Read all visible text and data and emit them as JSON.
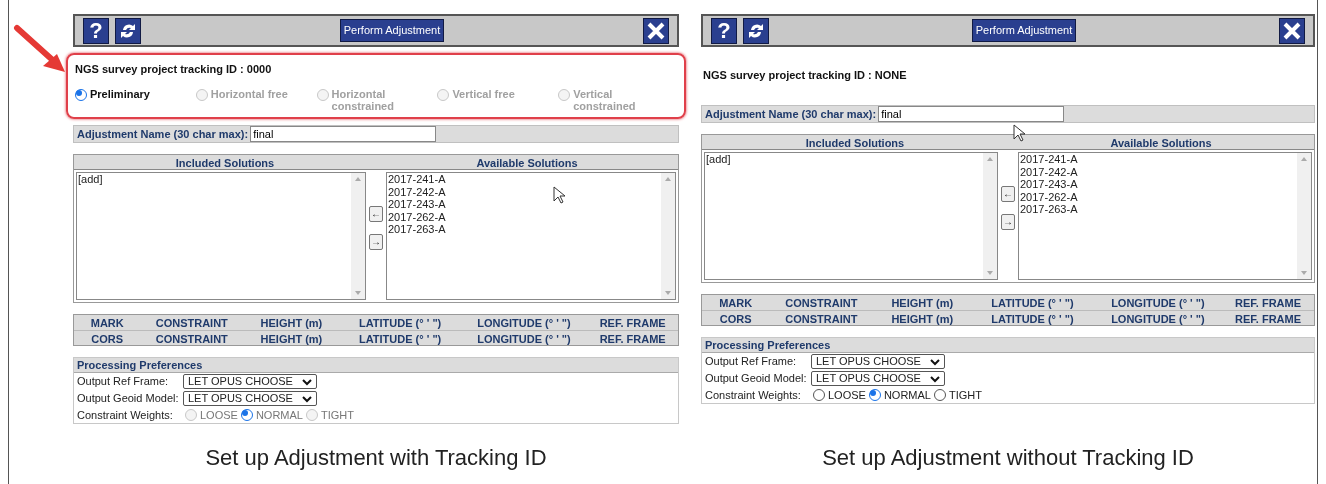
{
  "panels": [
    {
      "toolbar": {
        "help_key": "?",
        "action": "Perform Adjustment"
      },
      "tracking": {
        "label": "NGS survey project tracking ID : 0000",
        "highlighted": true,
        "options": [
          {
            "label": "Preliminary",
            "selected": true,
            "disabled": false
          },
          {
            "label": "Horizontal free",
            "selected": false,
            "disabled": true
          },
          {
            "label": "Horizontal constrained",
            "selected": false,
            "disabled": true
          },
          {
            "label": "Vertical free",
            "selected": false,
            "disabled": true
          },
          {
            "label": "Vertical constrained",
            "selected": false,
            "disabled": true
          }
        ]
      },
      "name_field": {
        "label": "Adjustment Name (30 char max):",
        "value": "final"
      },
      "solutions": {
        "included_header": "Included Solutions",
        "available_header": "Available Solutions",
        "included": [
          "[add]"
        ],
        "available": [
          "2017-241-A",
          "2017-242-A",
          "2017-243-A",
          "2017-262-A",
          "2017-263-A"
        ],
        "move_buttons": [
          "←",
          "→"
        ]
      },
      "station_table": [
        [
          "MARK",
          "CONSTRAINT",
          "HEIGHT (m)",
          "LATITUDE (° ' \")",
          "LONGITUDE (° ' \")",
          "REF. FRAME"
        ],
        [
          "CORS",
          "CONSTRAINT",
          "HEIGHT (m)",
          "LATITUDE (° ' \")",
          "LONGITUDE (° ' \")",
          "REF. FRAME"
        ]
      ],
      "preferences": {
        "title": "Processing Preferences",
        "fields": [
          {
            "label": "Output Ref Frame:",
            "value": "LET OPUS CHOOSE"
          },
          {
            "label": "Output Geoid Model:",
            "value": "LET OPUS CHOOSE"
          }
        ],
        "weights": {
          "label": "Constraint Weights:",
          "disabled": true,
          "options": [
            {
              "label": "LOOSE",
              "selected": false
            },
            {
              "label": "NORMAL",
              "selected": true
            },
            {
              "label": "TIGHT",
              "selected": false
            }
          ]
        }
      },
      "caption": "Set up Adjustment with Tracking ID"
    },
    {
      "toolbar": {
        "help_key": "?",
        "action": "Perform Adjustment"
      },
      "tracking": {
        "label": "NGS survey project tracking ID : NONE"
      },
      "name_field": {
        "label": "Adjustment Name (30 char max):",
        "value": "final"
      },
      "solutions": {
        "included_header": "Included Solutions",
        "available_header": "Available Solutions",
        "included": [
          "[add]"
        ],
        "available": [
          "2017-241-A",
          "2017-242-A",
          "2017-243-A",
          "2017-262-A",
          "2017-263-A"
        ],
        "move_buttons": [
          "←",
          "→"
        ]
      },
      "station_table": [
        [
          "MARK",
          "CONSTRAINT",
          "HEIGHT (m)",
          "LATITUDE (° ' \")",
          "LONGITUDE (° ' \")",
          "REF. FRAME"
        ],
        [
          "CORS",
          "CONSTRAINT",
          "HEIGHT (m)",
          "LATITUDE (° ' \")",
          "LONGITUDE (° ' \")",
          "REF. FRAME"
        ]
      ],
      "preferences": {
        "title": "Processing Preferences",
        "fields": [
          {
            "label": "Output Ref Frame:",
            "value": "LET OPUS CHOOSE"
          },
          {
            "label": "Output Geoid Model:",
            "value": "LET OPUS CHOOSE"
          }
        ],
        "weights": {
          "label": "Constraint Weights:",
          "disabled": false,
          "options": [
            {
              "label": "LOOSE",
              "selected": false
            },
            {
              "label": "NORMAL",
              "selected": true
            },
            {
              "label": "TIGHT",
              "selected": false
            }
          ]
        }
      },
      "caption": "Set up Adjustment without Tracking ID"
    }
  ]
}
